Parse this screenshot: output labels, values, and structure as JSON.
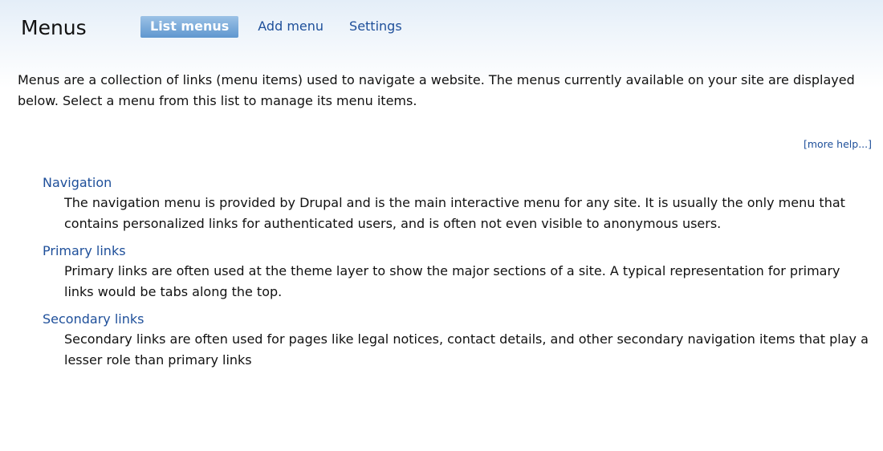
{
  "header": {
    "title": "Menus",
    "tabs": [
      {
        "label": "List menus",
        "active": true
      },
      {
        "label": "Add menu",
        "active": false
      },
      {
        "label": "Settings",
        "active": false
      }
    ]
  },
  "intro": {
    "text": "Menus are a collection of links (menu items) used to navigate a website. The menus currently available on your site are displayed below. Select a menu from this list to manage its menu items."
  },
  "more_help": "[more help...]",
  "menus": [
    {
      "name": "Navigation",
      "description": "The navigation menu is provided by Drupal and is the main interactive menu for any site. It is usually the only menu that contains personalized links for authenticated users, and is often not even visible to anonymous users."
    },
    {
      "name": "Primary links",
      "description": "Primary links are often used at the theme layer to show the major sections of a site. A typical representation for primary links would be tabs along the top."
    },
    {
      "name": "Secondary links",
      "description": "Secondary links are often used for pages like legal notices, contact details, and other secondary navigation items that play a lesser role than primary links"
    }
  ],
  "colors": {
    "link": "#1e4f9a",
    "active_tab_top": "#9cc2e6",
    "active_tab_bottom": "#5f97cf",
    "header_bg": "#e4eef8",
    "text": "#111111"
  }
}
